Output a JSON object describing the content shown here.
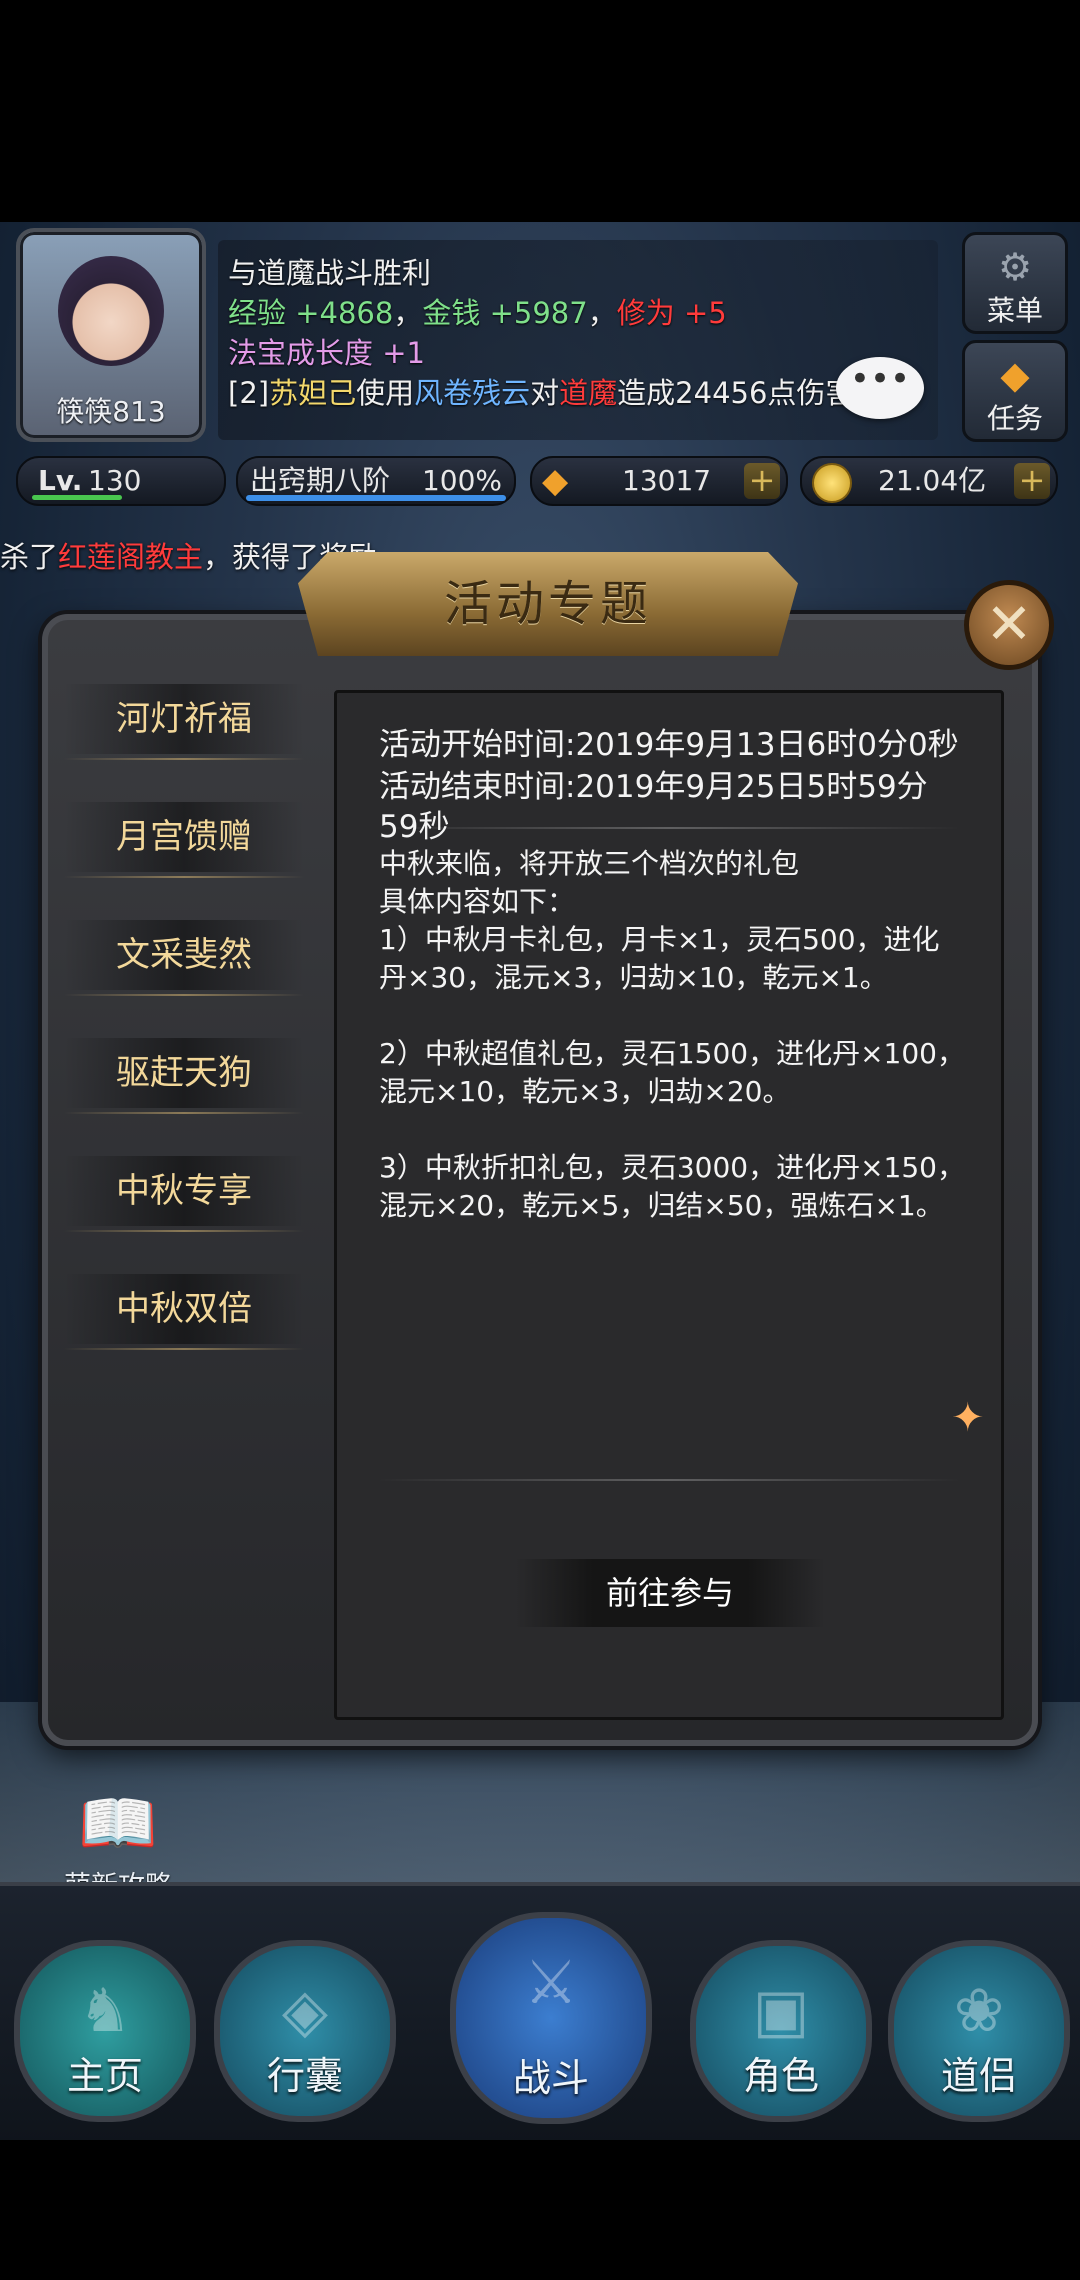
{
  "player": {
    "name": "筷筷813",
    "level_label": "Lv.",
    "level": "130"
  },
  "log": {
    "line1": "与道魔战斗胜利",
    "line2": {
      "exp_label": "经验",
      "exp_value": "+4868",
      "sep1": "，",
      "gold_label": "金钱",
      "gold_value": "+5987",
      "sep2": "，",
      "cult_label": "修为",
      "cult_value": "+5"
    },
    "line3": {
      "label": "法宝成长度",
      "value": "+1"
    },
    "line4": {
      "prefix": "[2]",
      "actor": "苏妲己",
      "verb": "使用",
      "skill": "风卷残云",
      "to": "对",
      "target": "道魔",
      "result": "造成24456点伤害"
    }
  },
  "chat_bubble": "•••",
  "side_buttons": {
    "menu": "菜单",
    "task": "任务"
  },
  "stats": {
    "stage": "出窍期八阶",
    "stage_progress": "100%",
    "gems": "13017",
    "gold": "21.04亿"
  },
  "ticker": {
    "prefix": "杀了",
    "name": "红莲阁教主",
    "suffix": "，获得了奖励"
  },
  "dialog": {
    "title": "活动专题",
    "tabs": [
      "河灯祈福",
      "月宫馈赠",
      "文采斐然",
      "驱赶天狗",
      "中秋专享",
      "中秋双倍"
    ],
    "start_time": "活动开始时间:2019年9月13日6时0分0秒",
    "end_time": "活动结束时间:2019年9月25日5时59分59秒",
    "intro1": "中秋来临，将开放三个档次的礼包",
    "intro2": "具体内容如下：",
    "item1": "1）中秋月卡礼包，月卡×1，灵石500，进化丹×30，混元×3，归劫×10，乾元×1。",
    "item2": "2）中秋超值礼包，灵石1500，进化丹×100，混元×10，乾元×3，归劫×20。",
    "item3": "3）中秋折扣礼包，灵石3000，进化丹×150，混元×20，乾元×5，归结×50，强炼石×1。",
    "go_button": "前往参与"
  },
  "guide": "萌新攻略",
  "bottom_nav": [
    "主页",
    "行囊",
    "战斗",
    "角色",
    "道侣"
  ],
  "colors": {
    "accent_gold": "#f3d89a",
    "red": "#ff3b3b",
    "green": "#7fe08a"
  }
}
